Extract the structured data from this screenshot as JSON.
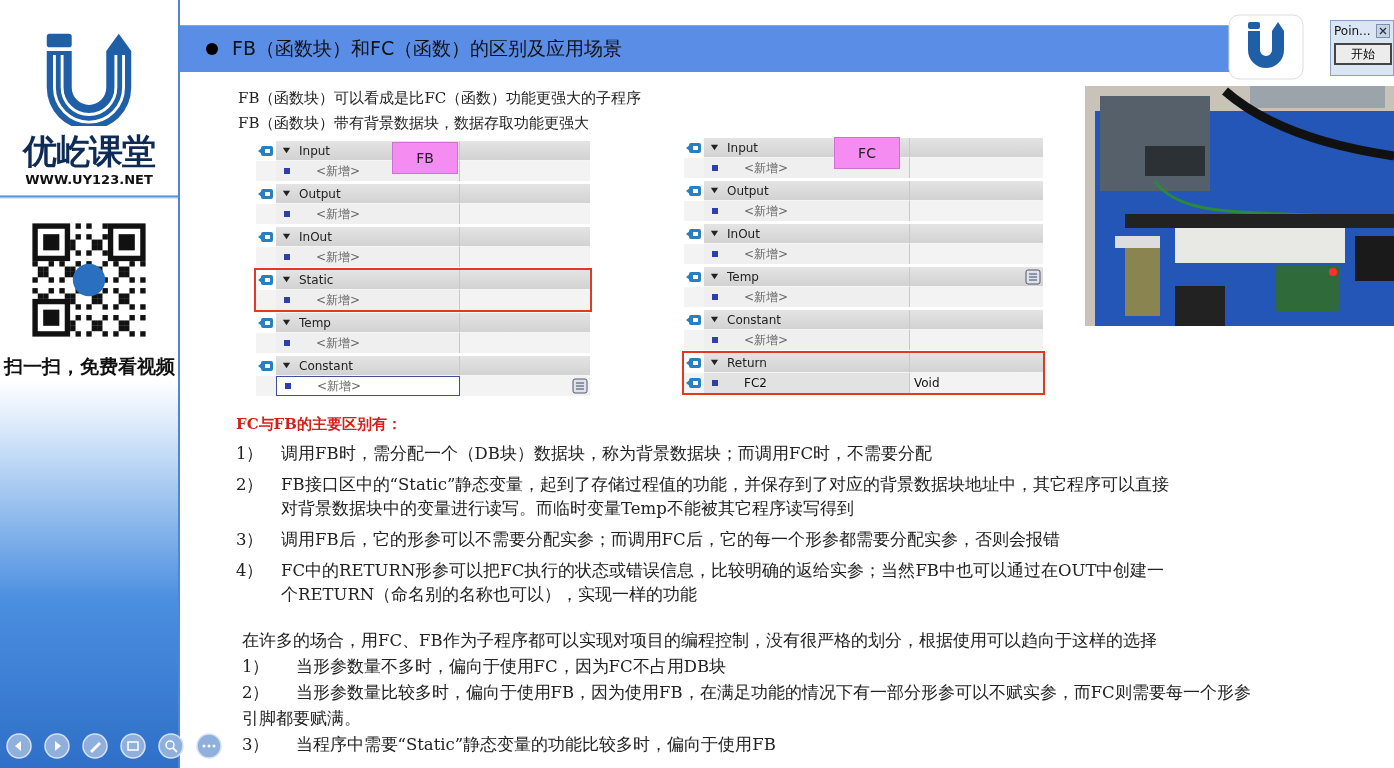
{
  "sidebar": {
    "brand": "优屹课堂",
    "url": "WWW.UY123.NET",
    "qr_caption": "扫一扫，免费看视频"
  },
  "title": "FB（函数块）和FC（函数）的区别及应用场景",
  "intro": [
    "FB（函数块）可以看成是比FC（函数）功能更强大的子程序",
    "FB（函数块）带有背景数据块，数据存取功能更强大"
  ],
  "tables": [
    {
      "tag": "FB",
      "sections": [
        {
          "name": "Input",
          "expanded": true,
          "highlighted": false,
          "menu_button": false,
          "rows": [
            {
              "kind": "new",
              "name": "<新增>",
              "selected": false
            }
          ]
        },
        {
          "name": "Output",
          "expanded": true,
          "highlighted": false,
          "menu_button": false,
          "rows": [
            {
              "kind": "new",
              "name": "<新增>",
              "selected": false
            }
          ]
        },
        {
          "name": "InOut",
          "expanded": true,
          "highlighted": false,
          "menu_button": false,
          "rows": [
            {
              "kind": "new",
              "name": "<新增>",
              "selected": false
            }
          ]
        },
        {
          "name": "Static",
          "expanded": true,
          "highlighted": true,
          "menu_button": false,
          "rows": [
            {
              "kind": "new",
              "name": "<新增>",
              "selected": false
            }
          ]
        },
        {
          "name": "Temp",
          "expanded": true,
          "highlighted": false,
          "menu_button": false,
          "rows": [
            {
              "kind": "new",
              "name": "<新增>",
              "selected": false
            }
          ]
        },
        {
          "name": "Constant",
          "expanded": true,
          "highlighted": false,
          "menu_button": false,
          "rows": [
            {
              "kind": "new",
              "name": "<新增>",
              "selected": true
            }
          ]
        }
      ]
    },
    {
      "tag": "FC",
      "sections": [
        {
          "name": "Input",
          "expanded": true,
          "highlighted": false,
          "menu_button": false,
          "rows": [
            {
              "kind": "new",
              "name": "<新增>",
              "selected": false
            }
          ]
        },
        {
          "name": "Output",
          "expanded": true,
          "highlighted": false,
          "menu_button": false,
          "rows": [
            {
              "kind": "new",
              "name": "<新增>",
              "selected": false
            }
          ]
        },
        {
          "name": "InOut",
          "expanded": true,
          "highlighted": false,
          "menu_button": false,
          "rows": [
            {
              "kind": "new",
              "name": "<新增>",
              "selected": false
            }
          ]
        },
        {
          "name": "Temp",
          "expanded": true,
          "highlighted": false,
          "menu_button": true,
          "rows": [
            {
              "kind": "new",
              "name": "<新增>",
              "selected": false
            }
          ]
        },
        {
          "name": "Constant",
          "expanded": true,
          "highlighted": false,
          "menu_button": false,
          "rows": [
            {
              "kind": "new",
              "name": "<新增>",
              "selected": false
            }
          ]
        },
        {
          "name": "Return",
          "expanded": true,
          "highlighted": true,
          "menu_button": false,
          "rows": [
            {
              "kind": "param",
              "name": "FC2",
              "type": "Void",
              "selected": false
            }
          ]
        }
      ]
    }
  ],
  "differences": {
    "heading": "FC与FB的主要区别有：",
    "items": [
      {
        "num": "1）",
        "text": "调用FB时，需分配一个（DB块）数据块，称为背景数据块；而调用FC时，不需要分配"
      },
      {
        "num": "2）",
        "text": "FB接口区中的“Static”静态变量，起到了存储过程值的功能，并保存到了对应的背景数据块地址中，其它程序可以直接对背景数据块中的变量进行读写。而临时变量Temp不能被其它程序读写得到"
      },
      {
        "num": "3）",
        "text": "调用FB后，它的形参可以不需要分配实参；而调用FC后，它的每一个形参都需要分配实参，否则会报错"
      },
      {
        "num": "4）",
        "text": "FC中的RETURN形参可以把FC执行的状态或错误信息，比较明确的返给实参；当然FB中也可以通过在OUT中创建一个RETURN（命名别的名称也可以），实现一样的功能"
      }
    ]
  },
  "usage": {
    "intro": "在许多的场合，用FC、FB作为子程序都可以实现对项目的编程控制，没有很严格的划分，根据使用可以趋向于这样的选择",
    "items": [
      {
        "num": "1）",
        "text": "当形参数量不多时，偏向于使用FC，因为FC不占用DB块"
      },
      {
        "num": "2）",
        "text": "当形参数量比较多时，偏向于使用FB，因为使用FB，在满足功能的情况下有一部分形参可以不赋实参，而FC则需要每一个形参引脚都要赋满。"
      },
      {
        "num": "3）",
        "text": "当程序中需要“Static”静态变量的功能比较多时，偏向于使用FB"
      }
    ]
  },
  "pointer_dialog": {
    "title": "Poin...",
    "button": "开始"
  }
}
